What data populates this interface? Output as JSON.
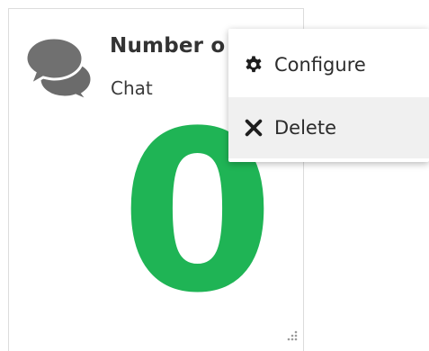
{
  "widget": {
    "title": "Number o",
    "subtitle": "Chat",
    "value": "0",
    "icon": "chat-bubbles-icon",
    "value_color": "#1fb455"
  },
  "context_menu": {
    "items": [
      {
        "label": "Configure",
        "icon": "gear-icon"
      },
      {
        "label": "Delete",
        "icon": "close-icon"
      }
    ]
  }
}
